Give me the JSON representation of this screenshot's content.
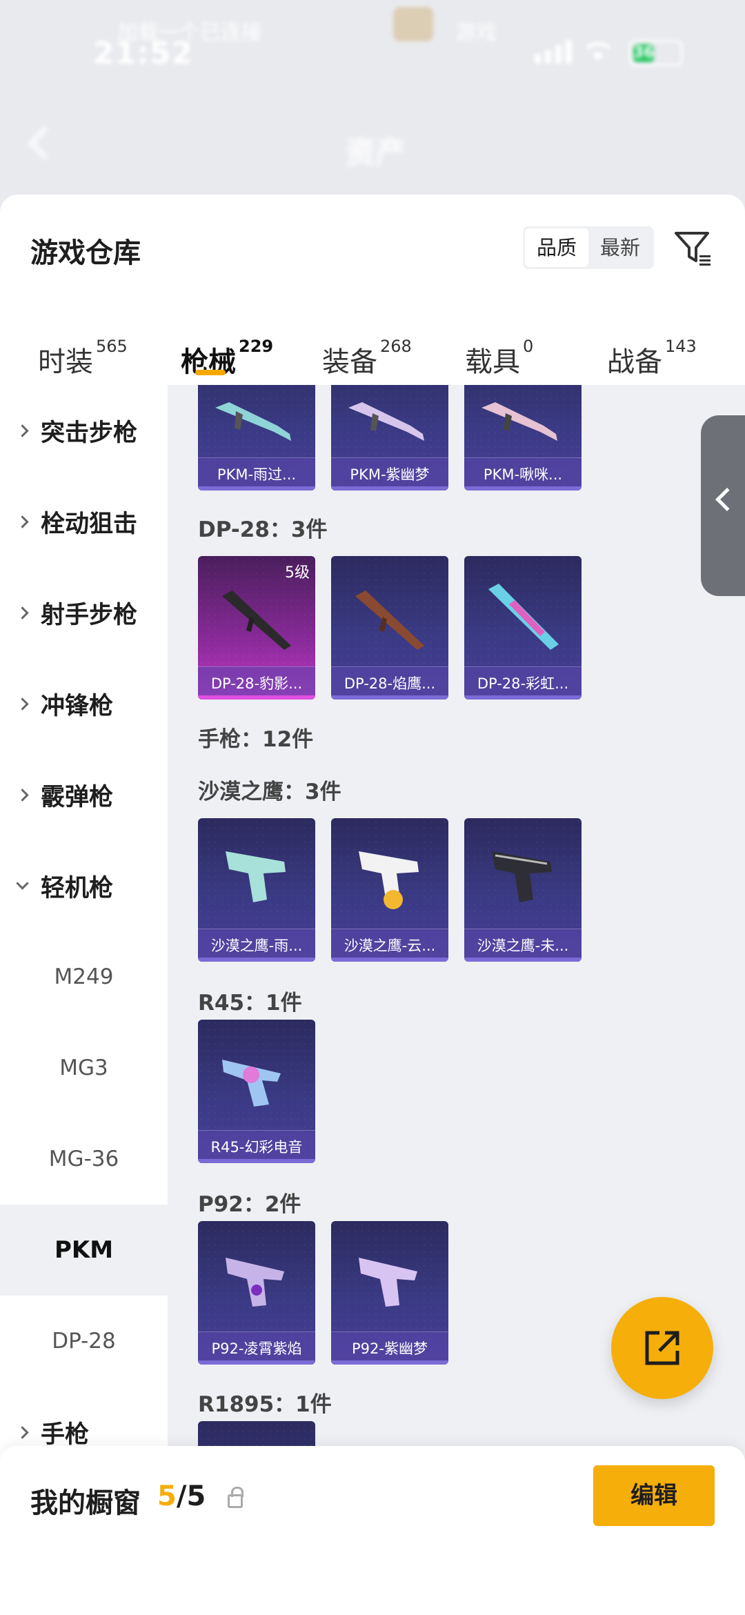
{
  "status_bar": {
    "time": "21:52",
    "notification_left": "加载一个已连接",
    "notification_right": "游戏",
    "battery": "36"
  },
  "header": {
    "title": "资产"
  },
  "sheet": {
    "title": "游戏仓库",
    "sort": {
      "quality": "品质",
      "newest": "最新"
    }
  },
  "tabs": [
    {
      "label": "时装",
      "count": "565"
    },
    {
      "label": "枪械",
      "count": "229"
    },
    {
      "label": "装备",
      "count": "268"
    },
    {
      "label": "载具",
      "count": "0"
    },
    {
      "label": "战备",
      "count": "143"
    }
  ],
  "sidebar": {
    "categories": [
      "突击步枪",
      "栓动狙击",
      "射手步枪",
      "冲锋枪",
      "霰弹枪",
      "轻机枪"
    ],
    "subitems": [
      "M249",
      "MG3",
      "MG-36",
      "PKM",
      "DP-28"
    ],
    "last_category": "手枪"
  },
  "content": {
    "pkm_cards": [
      "PKM-雨过...",
      "PKM-紫幽梦",
      "PKM-啾咪..."
    ],
    "dp28_title": "DP-28：3件",
    "dp28_cards": [
      "DP-28-豹影...",
      "DP-28-焰鹰...",
      "DP-28-彩虹..."
    ],
    "dp28_level": "5级",
    "pistol_title": "手枪：12件",
    "deagle_title": "沙漠之鹰：3件",
    "deagle_cards": [
      "沙漠之鹰-雨...",
      "沙漠之鹰-云...",
      "沙漠之鹰-未..."
    ],
    "r45_title": "R45：1件",
    "r45_cards": [
      "R45-幻彩电音"
    ],
    "p92_title": "P92：2件",
    "p92_cards": [
      "P92-凌霄紫焰",
      "P92-紫幽梦"
    ],
    "r1895_title": "R1895：1件"
  },
  "bottom": {
    "title": "我的橱窗",
    "current": "5",
    "total": "/5",
    "edit_label": "编辑"
  },
  "colors": {
    "accent": "#f5ae0a",
    "card_bg": "#3a3a84",
    "card_highlight": "#c23ac8"
  }
}
